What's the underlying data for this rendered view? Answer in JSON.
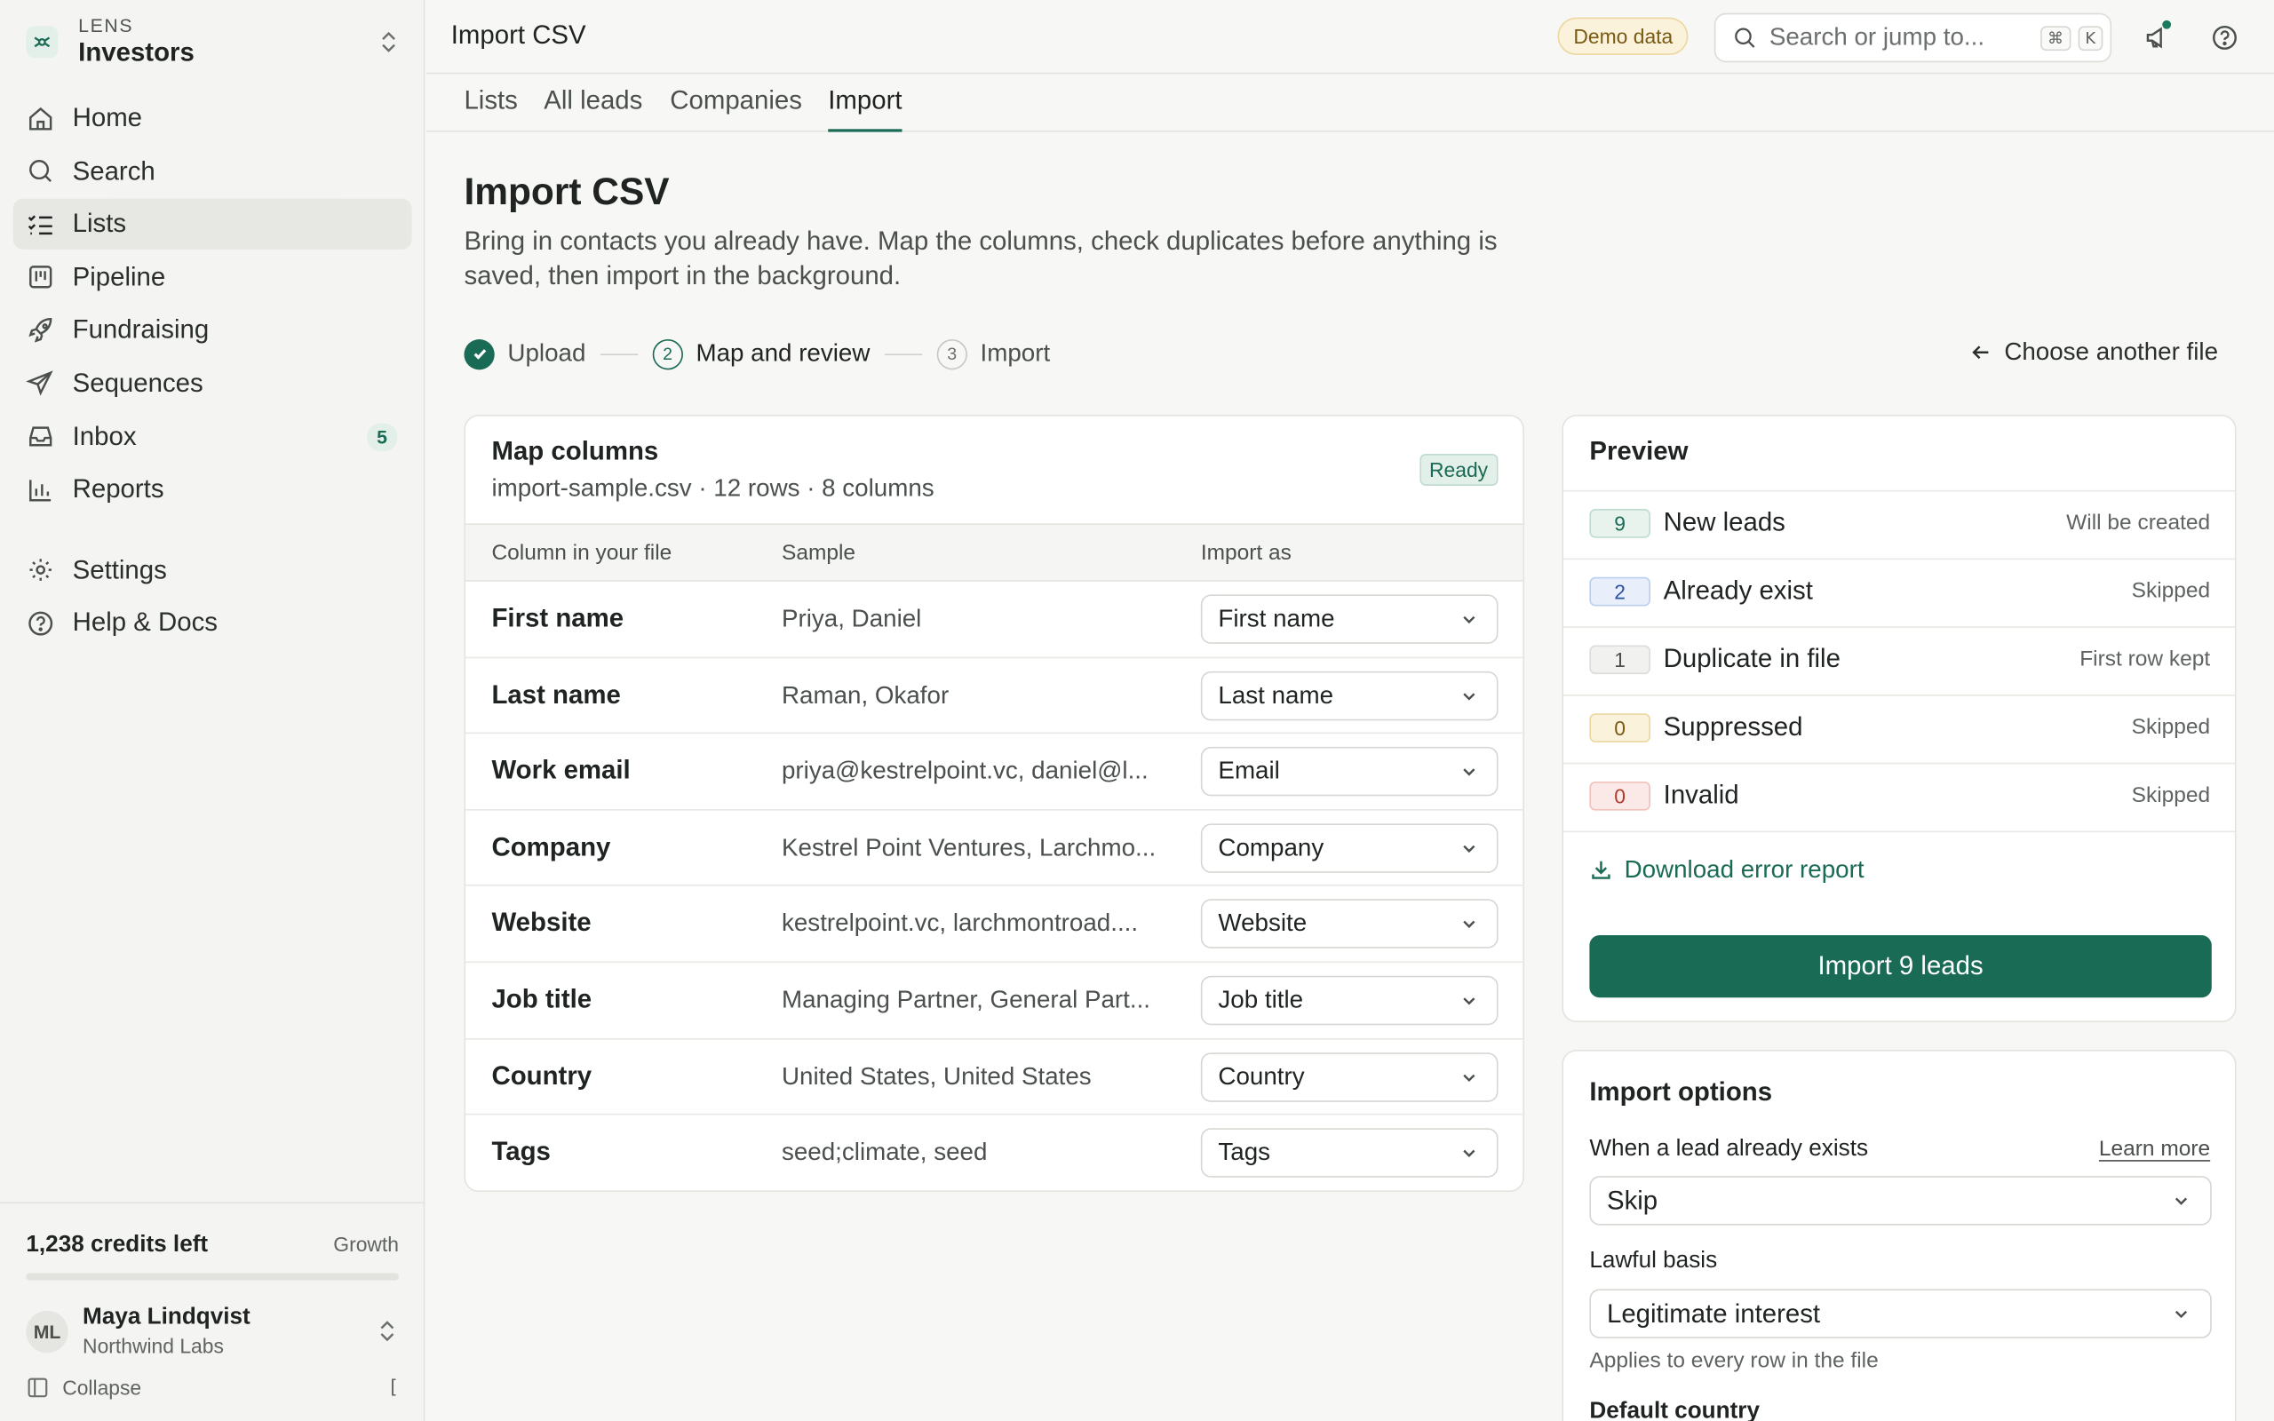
{
  "workspace": {
    "brand": "LENS",
    "name": "Investors"
  },
  "sidebar": {
    "items": [
      {
        "label": "Home",
        "icon": "home-icon"
      },
      {
        "label": "Search",
        "icon": "search-icon"
      },
      {
        "label": "Lists",
        "icon": "list-check-icon",
        "active": true
      },
      {
        "label": "Pipeline",
        "icon": "kanban-icon"
      },
      {
        "label": "Fundraising",
        "icon": "rocket-icon"
      },
      {
        "label": "Sequences",
        "icon": "send-icon"
      },
      {
        "label": "Inbox",
        "icon": "inbox-icon",
        "badge": "5"
      },
      {
        "label": "Reports",
        "icon": "bar-chart-icon"
      }
    ],
    "secondary": [
      {
        "label": "Settings",
        "icon": "gear-icon"
      },
      {
        "label": "Help & Docs",
        "icon": "help-circle-icon"
      }
    ],
    "credits_label": "1,238 credits left",
    "plan": "Growth",
    "credits_fraction": 0,
    "user": {
      "initials": "ML",
      "name": "Maya Lindqvist",
      "org": "Northwind Labs"
    },
    "collapse_label": "Collapse",
    "collapse_shortcut": "["
  },
  "topbar": {
    "title": "Import CSV",
    "demo_badge": "Demo data",
    "search_placeholder": "Search or jump to...",
    "shortcut_cmd": "⌘",
    "shortcut_key": "K"
  },
  "tabs": [
    {
      "label": "Lists"
    },
    {
      "label": "All leads"
    },
    {
      "label": "Companies"
    },
    {
      "label": "Import",
      "active": true
    }
  ],
  "page": {
    "title": "Import CSV",
    "subtitle": "Bring in contacts you already have. Map the columns, check duplicates before anything is saved, then import in the background."
  },
  "stepper": {
    "steps": [
      {
        "num": "1",
        "label": "Upload",
        "state": "done"
      },
      {
        "num": "2",
        "label": "Map and review",
        "state": "current"
      },
      {
        "num": "3",
        "label": "Import",
        "state": "next"
      }
    ],
    "choose_label": "Choose another file"
  },
  "map": {
    "title": "Map columns",
    "meta": "import-sample.csv · 12 rows · 8 columns",
    "status": "Ready",
    "headers": {
      "column": "Column in your file",
      "sample": "Sample",
      "import_as": "Import as"
    },
    "rows": [
      {
        "column": "First name",
        "sample": "Priya, Daniel",
        "import_as": "First name"
      },
      {
        "column": "Last name",
        "sample": "Raman, Okafor",
        "import_as": "Last name"
      },
      {
        "column": "Work email",
        "sample": "priya@kestrelpoint.vc, daniel@l...",
        "import_as": "Email"
      },
      {
        "column": "Company",
        "sample": "Kestrel Point Ventures, Larchmo...",
        "import_as": "Company"
      },
      {
        "column": "Website",
        "sample": "kestrelpoint.vc, larchmontroad....",
        "import_as": "Website"
      },
      {
        "column": "Job title",
        "sample": "Managing Partner, General Part...",
        "import_as": "Job title"
      },
      {
        "column": "Country",
        "sample": "United States, United States",
        "import_as": "Country"
      },
      {
        "column": "Tags",
        "sample": "seed;climate, seed",
        "import_as": "Tags"
      }
    ]
  },
  "preview": {
    "title": "Preview",
    "rows": [
      {
        "count": "9",
        "label": "New leads",
        "status": "Will be created",
        "tone": "green"
      },
      {
        "count": "2",
        "label": "Already exist",
        "status": "Skipped",
        "tone": "blue"
      },
      {
        "count": "1",
        "label": "Duplicate in file",
        "status": "First row kept",
        "tone": "gray"
      },
      {
        "count": "0",
        "label": "Suppressed",
        "status": "Skipped",
        "tone": "amber"
      },
      {
        "count": "0",
        "label": "Invalid",
        "status": "Skipped",
        "tone": "red"
      }
    ],
    "download_label": "Download error report",
    "import_button": "Import 9 leads"
  },
  "options": {
    "title": "Import options",
    "exists_label": "When a lead already exists",
    "learn_more": "Learn more",
    "exists_value": "Skip",
    "lawful_label": "Lawful basis",
    "lawful_value": "Legitimate interest",
    "lawful_help": "Applies to every row in the file",
    "country_label": "Default country"
  },
  "colors": {
    "accent": "#1a6b55",
    "demo_badge": "#fbf2dc"
  }
}
